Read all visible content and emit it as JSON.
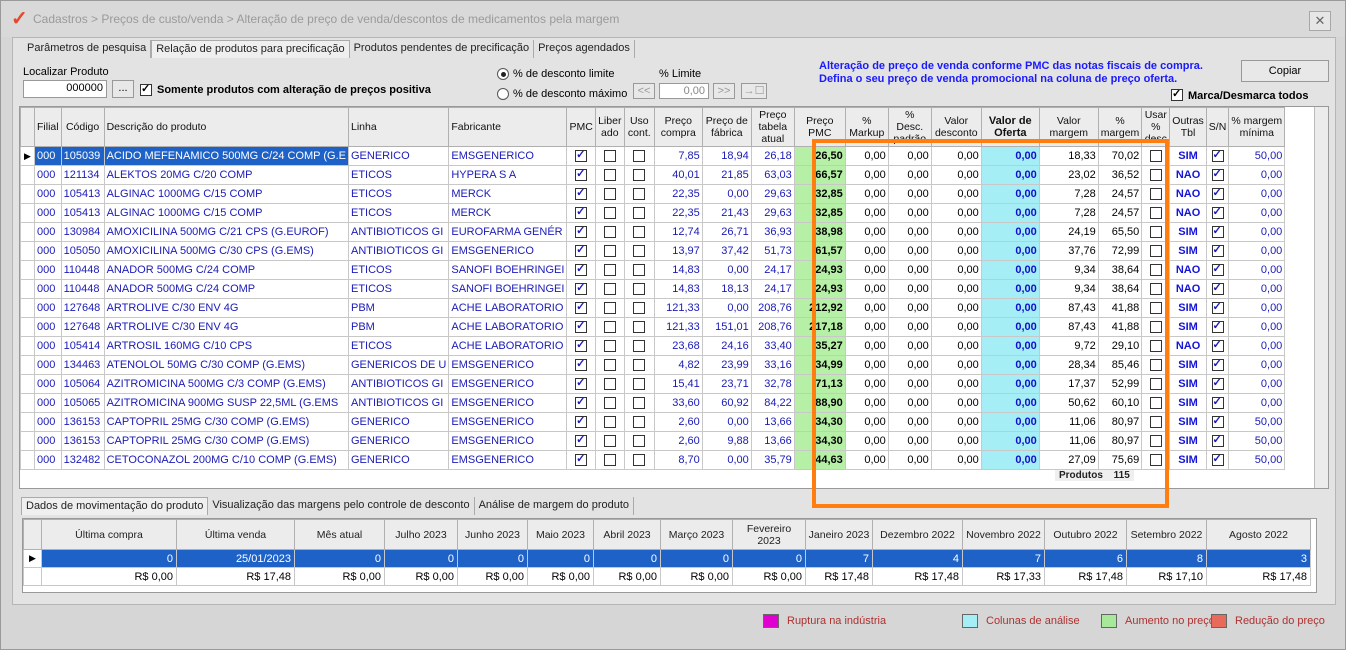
{
  "window": {
    "title": "Cadastros > Preços de custo/venda > Alteração de preço de venda/descontos de medicamentos pela margem",
    "close_label": "✕"
  },
  "tabs": [
    "Parâmetros de pesquisa",
    "Relação de produtos para precificação",
    "Produtos pendentes de precificação",
    "Preços agendados"
  ],
  "search": {
    "label": "Localizar Produto",
    "value": "000000",
    "button": "...",
    "only_positive_label": "Somente produtos com alteração de preços positiva",
    "only_positive_checked": true
  },
  "discount": {
    "option_limit": "% de desconto limite",
    "option_max": "% de desconto máximo",
    "selected": "limit",
    "limit_label": "% Limite",
    "limit_value": "0,00",
    "btn_prev": "<<",
    "btn_next": ">>",
    "btn_apply": "→☐"
  },
  "info": {
    "line1": "Alteração de preço de venda conforme PMC das notas fiscais de compra.",
    "line2": "Defina o seu preço de venda promocional na coluna de preço oferta."
  },
  "copy_button": "Copiar",
  "mark_all": {
    "label": "Marca/Desmarca todos",
    "checked": true
  },
  "columns": [
    "Filial",
    "Código",
    "Descrição do produto",
    "Linha",
    "Fabricante",
    "PMC",
    "Liber ado",
    "Uso cont.",
    "Preço compra",
    "Preço de fábrica",
    "Preço tabela atual",
    "Preço PMC",
    "% Markup",
    "% Desc. padrão",
    "Valor desconto",
    "Valor de Oferta",
    "Valor margem",
    "% margem",
    "Usar % desc",
    "Outras Tbl",
    "S/N",
    "% margem mínima"
  ],
  "rows": [
    {
      "filial": "000",
      "codigo": "105039",
      "desc": "ACIDO MEFENAMICO 500MG C/24 COMP (G.E",
      "linha": "GENERICO",
      "fab": "EMSGENERICO",
      "compra": "7,85",
      "fabrica": "18,94",
      "tabela": "26,18",
      "pmc": "26,50",
      "markup": "0,00",
      "descp": "0,00",
      "vdesc": "0,00",
      "oferta": "0,00",
      "vmarg": "18,33",
      "pmarg": "70,02",
      "outras": "SIM",
      "mmin": "50,00",
      "sel": true
    },
    {
      "filial": "000",
      "codigo": "121134",
      "desc": "ALEKTOS 20MG C/20 COMP",
      "linha": "ETICOS",
      "fab": "HYPERA S A",
      "compra": "40,01",
      "fabrica": "21,85",
      "tabela": "63,03",
      "pmc": "66,57",
      "markup": "0,00",
      "descp": "0,00",
      "vdesc": "0,00",
      "oferta": "0,00",
      "vmarg": "23,02",
      "pmarg": "36,52",
      "outras": "NAO",
      "mmin": "0,00"
    },
    {
      "filial": "000",
      "codigo": "105413",
      "desc": "ALGINAC 1000MG C/15 COMP",
      "linha": "ETICOS",
      "fab": "MERCK",
      "compra": "22,35",
      "fabrica": "0,00",
      "tabela": "29,63",
      "pmc": "32,85",
      "markup": "0,00",
      "descp": "0,00",
      "vdesc": "0,00",
      "oferta": "0,00",
      "vmarg": "7,28",
      "pmarg": "24,57",
      "outras": "NAO",
      "mmin": "0,00"
    },
    {
      "filial": "000",
      "codigo": "105413",
      "desc": "ALGINAC 1000MG C/15 COMP",
      "linha": "ETICOS",
      "fab": "MERCK",
      "compra": "22,35",
      "fabrica": "21,43",
      "tabela": "29,63",
      "pmc": "32,85",
      "markup": "0,00",
      "descp": "0,00",
      "vdesc": "0,00",
      "oferta": "0,00",
      "vmarg": "7,28",
      "pmarg": "24,57",
      "outras": "NAO",
      "mmin": "0,00"
    },
    {
      "filial": "000",
      "codigo": "130984",
      "desc": "AMOXICILINA 500MG C/21 CPS (G.EUROF)",
      "linha": "ANTIBIOTICOS GI",
      "fab": "EUROFARMA GENÉR",
      "compra": "12,74",
      "fabrica": "26,71",
      "tabela": "36,93",
      "pmc": "38,98",
      "markup": "0,00",
      "descp": "0,00",
      "vdesc": "0,00",
      "oferta": "0,00",
      "vmarg": "24,19",
      "pmarg": "65,50",
      "outras": "SIM",
      "mmin": "0,00"
    },
    {
      "filial": "000",
      "codigo": "105050",
      "desc": "AMOXICILINA 500MG C/30 CPS (G.EMS)",
      "linha": "ANTIBIOTICOS GI",
      "fab": "EMSGENERICO",
      "compra": "13,97",
      "fabrica": "37,42",
      "tabela": "51,73",
      "pmc": "61,57",
      "markup": "0,00",
      "descp": "0,00",
      "vdesc": "0,00",
      "oferta": "0,00",
      "vmarg": "37,76",
      "pmarg": "72,99",
      "outras": "SIM",
      "mmin": "0,00"
    },
    {
      "filial": "000",
      "codigo": "110448",
      "desc": "ANADOR 500MG C/24 COMP",
      "linha": "ETICOS",
      "fab": "SANOFI BOEHRINGEI",
      "compra": "14,83",
      "fabrica": "0,00",
      "tabela": "24,17",
      "pmc": "24,93",
      "markup": "0,00",
      "descp": "0,00",
      "vdesc": "0,00",
      "oferta": "0,00",
      "vmarg": "9,34",
      "pmarg": "38,64",
      "outras": "NAO",
      "mmin": "0,00"
    },
    {
      "filial": "000",
      "codigo": "110448",
      "desc": "ANADOR 500MG C/24 COMP",
      "linha": "ETICOS",
      "fab": "SANOFI BOEHRINGEI",
      "compra": "14,83",
      "fabrica": "18,13",
      "tabela": "24,17",
      "pmc": "24,93",
      "markup": "0,00",
      "descp": "0,00",
      "vdesc": "0,00",
      "oferta": "0,00",
      "vmarg": "9,34",
      "pmarg": "38,64",
      "outras": "NAO",
      "mmin": "0,00"
    },
    {
      "filial": "000",
      "codigo": "127648",
      "desc": "ARTROLIVE C/30 ENV 4G",
      "linha": "PBM",
      "fab": "ACHE LABORATORIO",
      "compra": "121,33",
      "fabrica": "0,00",
      "tabela": "208,76",
      "pmc": "212,92",
      "markup": "0,00",
      "descp": "0,00",
      "vdesc": "0,00",
      "oferta": "0,00",
      "vmarg": "87,43",
      "pmarg": "41,88",
      "outras": "SIM",
      "mmin": "0,00"
    },
    {
      "filial": "000",
      "codigo": "127648",
      "desc": "ARTROLIVE C/30 ENV 4G",
      "linha": "PBM",
      "fab": "ACHE LABORATORIO",
      "compra": "121,33",
      "fabrica": "151,01",
      "tabela": "208,76",
      "pmc": "217,18",
      "markup": "0,00",
      "descp": "0,00",
      "vdesc": "0,00",
      "oferta": "0,00",
      "vmarg": "87,43",
      "pmarg": "41,88",
      "outras": "SIM",
      "mmin": "0,00"
    },
    {
      "filial": "000",
      "codigo": "105414",
      "desc": "ARTROSIL 160MG C/10 CPS",
      "linha": "ETICOS",
      "fab": "ACHE LABORATORIO",
      "compra": "23,68",
      "fabrica": "24,16",
      "tabela": "33,40",
      "pmc": "35,27",
      "markup": "0,00",
      "descp": "0,00",
      "vdesc": "0,00",
      "oferta": "0,00",
      "vmarg": "9,72",
      "pmarg": "29,10",
      "outras": "NAO",
      "mmin": "0,00"
    },
    {
      "filial": "000",
      "codigo": "134463",
      "desc": "ATENOLOL 50MG C/30 COMP (G.EMS)",
      "linha": "GENERICOS DE U",
      "fab": "EMSGENERICO",
      "compra": "4,82",
      "fabrica": "23,99",
      "tabela": "33,16",
      "pmc": "34,99",
      "markup": "0,00",
      "descp": "0,00",
      "vdesc": "0,00",
      "oferta": "0,00",
      "vmarg": "28,34",
      "pmarg": "85,46",
      "outras": "SIM",
      "mmin": "0,00"
    },
    {
      "filial": "000",
      "codigo": "105064",
      "desc": "AZITROMICINA 500MG C/3 COMP (G.EMS)",
      "linha": "ANTIBIOTICOS GI",
      "fab": "EMSGENERICO",
      "compra": "15,41",
      "fabrica": "23,71",
      "tabela": "32,78",
      "pmc": "71,13",
      "markup": "0,00",
      "descp": "0,00",
      "vdesc": "0,00",
      "oferta": "0,00",
      "vmarg": "17,37",
      "pmarg": "52,99",
      "outras": "SIM",
      "mmin": "0,00"
    },
    {
      "filial": "000",
      "codigo": "105065",
      "desc": "AZITROMICINA 900MG SUSP 22,5ML (G.EMS",
      "linha": "ANTIBIOTICOS GI",
      "fab": "EMSGENERICO",
      "compra": "33,60",
      "fabrica": "60,92",
      "tabela": "84,22",
      "pmc": "88,90",
      "markup": "0,00",
      "descp": "0,00",
      "vdesc": "0,00",
      "oferta": "0,00",
      "vmarg": "50,62",
      "pmarg": "60,10",
      "outras": "SIM",
      "mmin": "0,00"
    },
    {
      "filial": "000",
      "codigo": "136153",
      "desc": "CAPTOPRIL 25MG C/30 COMP (G.EMS)",
      "linha": "GENERICO",
      "fab": "EMSGENERICO",
      "compra": "2,60",
      "fabrica": "0,00",
      "tabela": "13,66",
      "pmc": "34,30",
      "markup": "0,00",
      "descp": "0,00",
      "vdesc": "0,00",
      "oferta": "0,00",
      "vmarg": "11,06",
      "pmarg": "80,97",
      "outras": "SIM",
      "mmin": "50,00"
    },
    {
      "filial": "000",
      "codigo": "136153",
      "desc": "CAPTOPRIL 25MG C/30 COMP (G.EMS)",
      "linha": "GENERICO",
      "fab": "EMSGENERICO",
      "compra": "2,60",
      "fabrica": "9,88",
      "tabela": "13,66",
      "pmc": "34,30",
      "markup": "0,00",
      "descp": "0,00",
      "vdesc": "0,00",
      "oferta": "0,00",
      "vmarg": "11,06",
      "pmarg": "80,97",
      "outras": "SIM",
      "mmin": "50,00"
    },
    {
      "filial": "000",
      "codigo": "132482",
      "desc": "CETOCONAZOL 200MG C/10 COMP (G.EMS)",
      "linha": "GENERICO",
      "fab": "EMSGENERICO",
      "compra": "8,70",
      "fabrica": "0,00",
      "tabela": "35,79",
      "pmc": "44,63",
      "markup": "0,00",
      "descp": "0,00",
      "vdesc": "0,00",
      "oferta": "0,00",
      "vmarg": "27,09",
      "pmarg": "75,69",
      "outras": "SIM",
      "mmin": "50,00"
    }
  ],
  "totals": {
    "label": "Produtos",
    "value": "115"
  },
  "bottom_tabs": [
    "Dados de movimentação do produto",
    "Visualização das margens pelo controle de desconto",
    "Análise de margem do produto"
  ],
  "movement": {
    "headers": [
      "Última compra",
      "Última venda",
      "Mês atual",
      "Julho 2023",
      "Junho 2023",
      "Maio 2023",
      "Abril 2023",
      "Março 2023",
      "Fevereiro 2023",
      "Janeiro 2023",
      "Dezembro 2022",
      "Novembro 2022",
      "Outubro 2022",
      "Setembro 2022",
      "Agosto 2022"
    ],
    "row1": [
      "0",
      "25/01/2023",
      "0",
      "0",
      "0",
      "0",
      "0",
      "0",
      "0",
      "7",
      "4",
      "7",
      "6",
      "8",
      "3"
    ],
    "row2": [
      "R$ 0,00",
      "R$ 17,48",
      "R$ 0,00",
      "R$ 0,00",
      "R$ 0,00",
      "R$ 0,00",
      "R$ 0,00",
      "R$ 0,00",
      "R$ 0,00",
      "R$ 17,48",
      "R$ 17,48",
      "R$ 17,33",
      "R$ 17,48",
      "R$ 17,10",
      "R$ 17,48"
    ]
  },
  "legend": [
    {
      "label": "Ruptura na indústria",
      "color": "#e000d0"
    },
    {
      "label": "Colunas de análise",
      "color": "#a6eef5"
    },
    {
      "label": "Aumento no preço",
      "color": "#a8e89a"
    },
    {
      "label": "Redução do preço",
      "color": "#e86a5a"
    }
  ],
  "colors": {
    "highlight": "#ff7e0f",
    "selection": "#1e62c8",
    "pmc_cell": "#b6f0a6",
    "offer_cell": "#a6eef5"
  }
}
